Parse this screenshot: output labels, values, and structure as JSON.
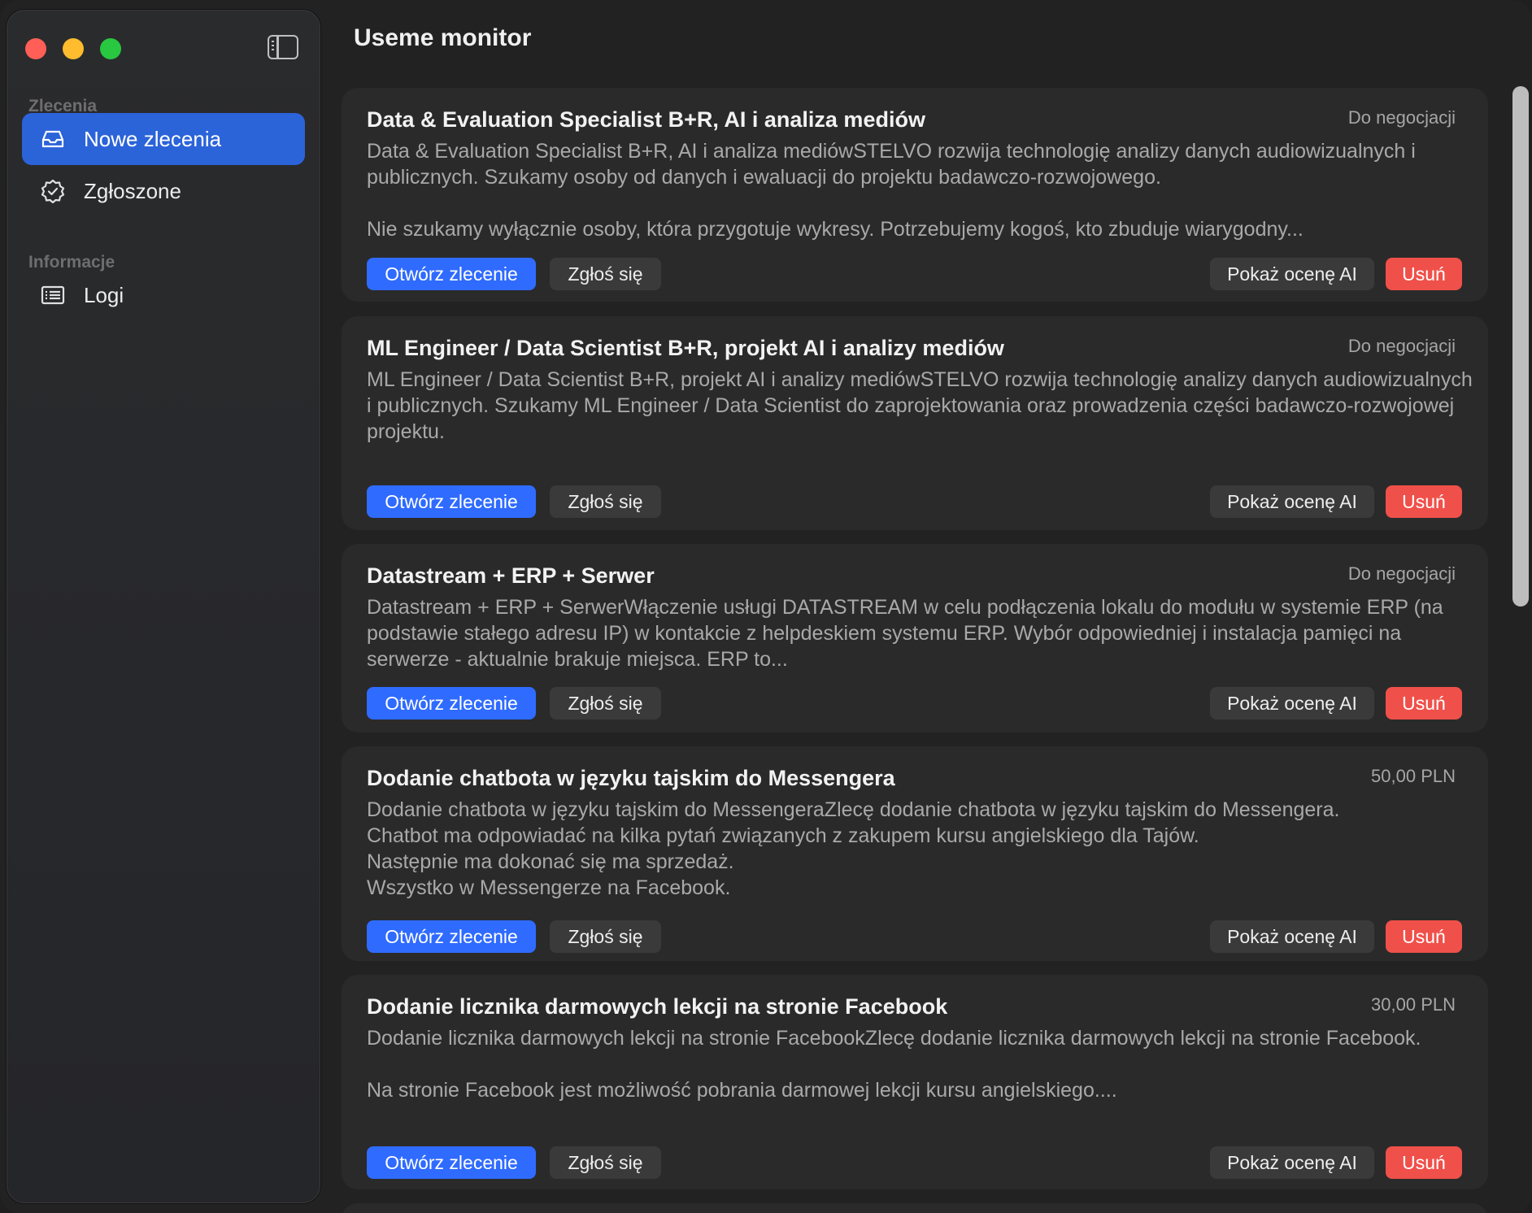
{
  "app": {
    "title": "Useme monitor"
  },
  "sidebar": {
    "sections": [
      {
        "label": "Zlecenia",
        "items": [
          {
            "label": "Nowe zlecenia",
            "icon": "tray-icon",
            "active": true
          },
          {
            "label": "Zgłoszone",
            "icon": "checkmark-seal-icon",
            "active": false
          }
        ]
      },
      {
        "label": "Informacje",
        "items": [
          {
            "label": "Logi",
            "icon": "list-icon",
            "active": false
          }
        ]
      }
    ]
  },
  "buttons": {
    "open": "Otwórz zlecenie",
    "apply": "Zgłoś się",
    "ai": "Pokaż ocenę AI",
    "delete": "Usuń"
  },
  "colors": {
    "accent": "#2f6bff",
    "danger": "#f0504a",
    "active_nav": "#2b63d9"
  },
  "jobs": [
    {
      "title": "Data & Evaluation Specialist B+R, AI i analiza mediów",
      "price": "Do negocjacji",
      "description": "Data & Evaluation Specialist B+R, AI i analiza mediówSTELVO rozwija technologię analizy danych audiowizualnych i publicznych. Szukamy osoby od danych i ewaluacji do projektu badawczo-rozwojowego.\n\nNie szukamy wyłącznie osoby, która przygotuje wykresy. Potrzebujemy kogoś, kto zbuduje wiarygodny..."
    },
    {
      "title": "ML Engineer / Data Scientist B+R, projekt AI i analizy mediów",
      "price": "Do negocjacji",
      "description": "ML Engineer / Data Scientist B+R, projekt AI i analizy mediówSTELVO rozwija technologię analizy danych audiowizualnych i publicznych. Szukamy ML Engineer / Data Scientist do zaprojektowania oraz prowadzenia części badawczo-rozwojowej projektu."
    },
    {
      "title": "Datastream + ERP + Serwer",
      "price": "Do negocjacji",
      "description": "Datastream + ERP + SerwerWłączenie usługi DATASTREAM w celu podłączenia lokalu do modułu w systemie ERP (na podstawie stałego adresu IP) w kontakcie z helpdeskiem systemu ERP. Wybór odpowiedniej i instalacja pamięci na serwerze - aktualnie brakuje miejsca. ERP to..."
    },
    {
      "title": "Dodanie chatbota w języku tajskim do Messengera",
      "price": "50,00 PLN",
      "description": "Dodanie chatbota w języku tajskim do MessengeraZlecę dodanie chatbota w języku tajskim do Messengera.\nChatbot ma odpowiadać na kilka pytań związanych z zakupem kursu angielskiego dla Tajów.\nNastępnie ma dokonać się ma sprzedaż.\nWszystko w Messengerze na Facebook."
    },
    {
      "title": "Dodanie licznika darmowych lekcji na stronie Facebook",
      "price": "30,00 PLN",
      "description": "Dodanie licznika darmowych lekcji na stronie FacebookZlecę dodanie licznika darmowych lekcji na stronie Facebook.\n\nNa stronie Facebook jest możliwość pobrania darmowej lekcji kursu angielskiego...."
    }
  ]
}
